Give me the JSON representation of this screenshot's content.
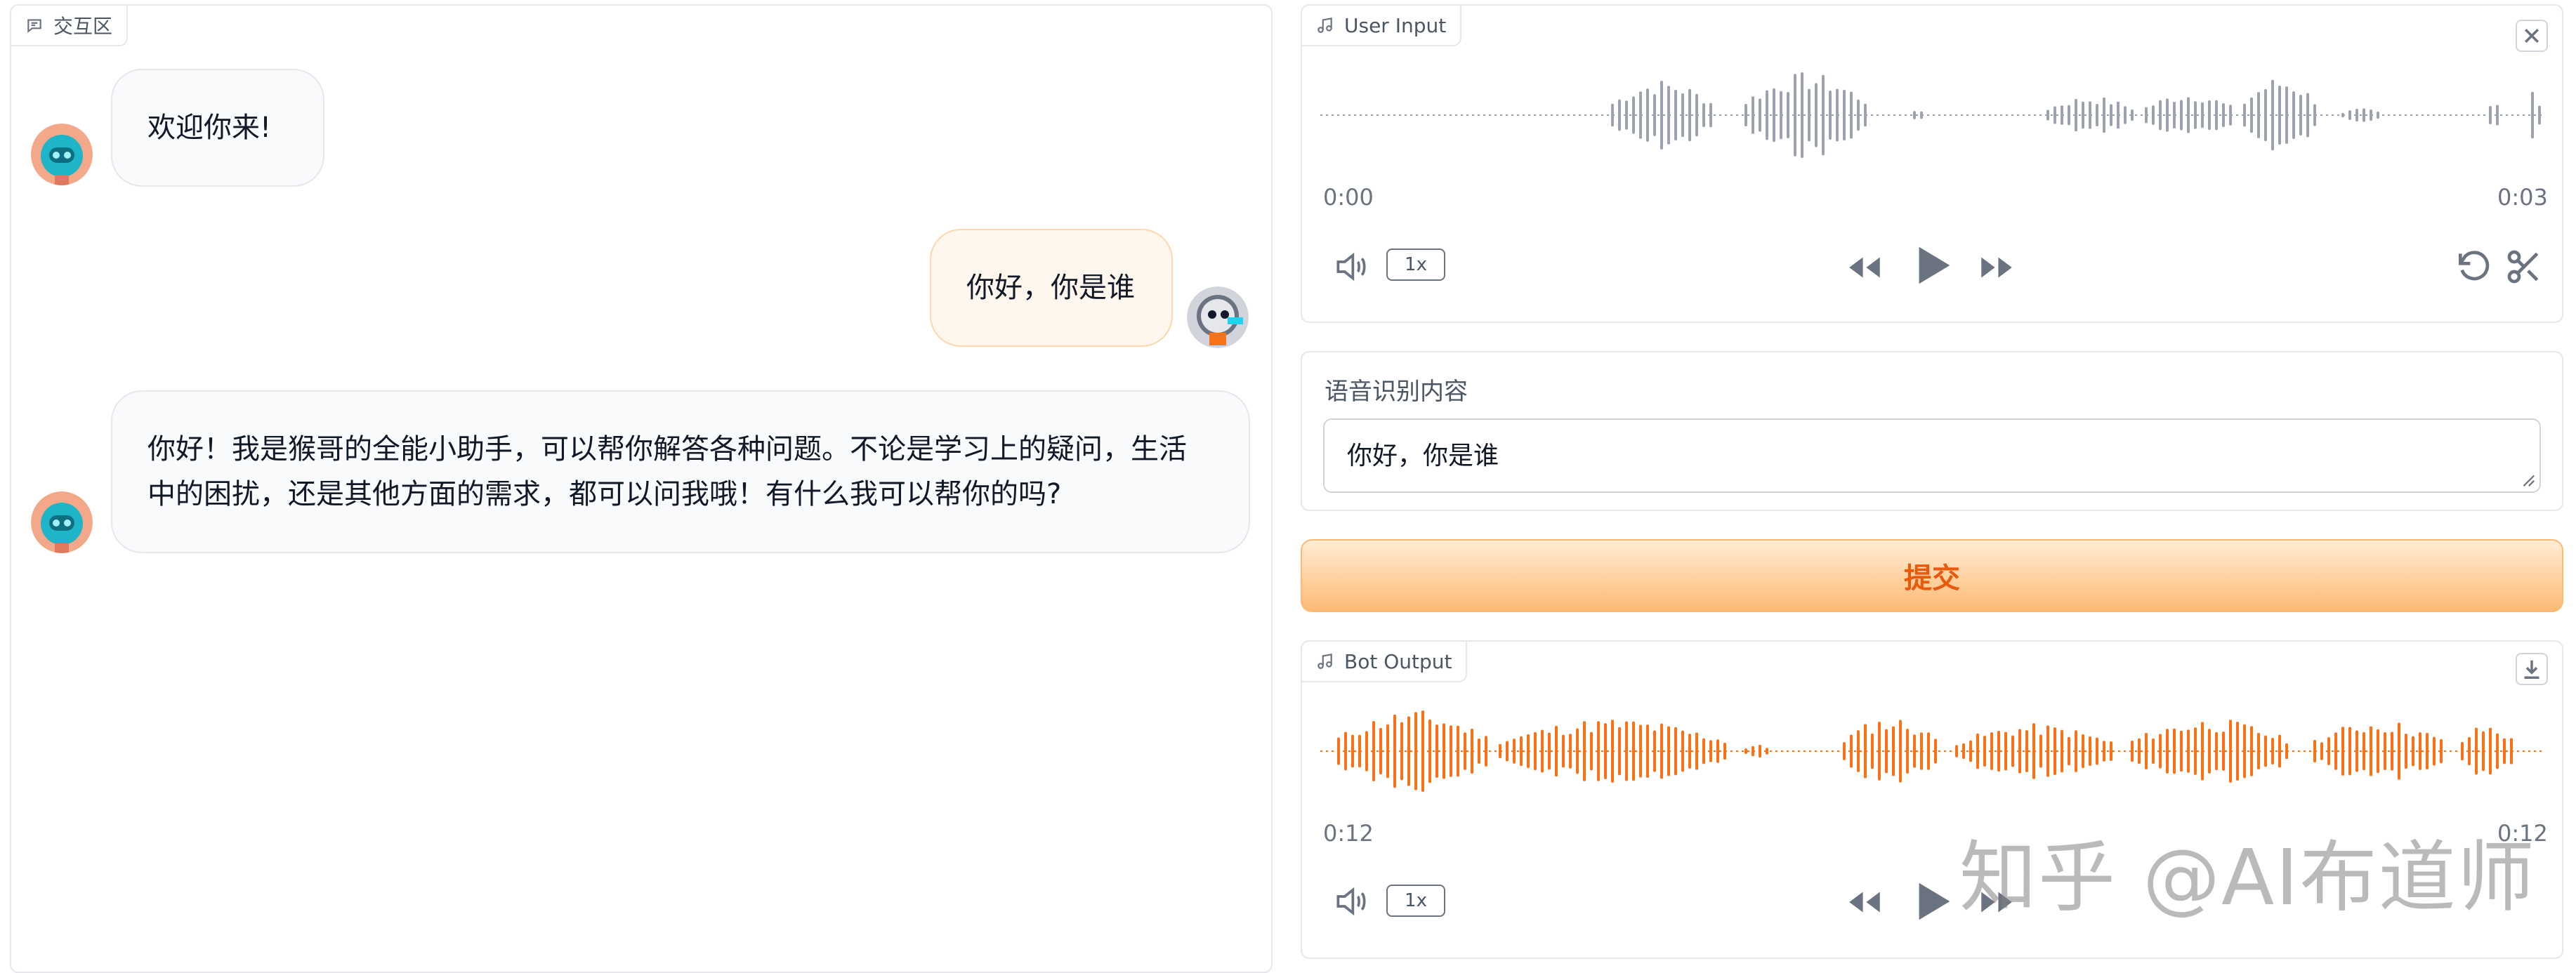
{
  "chat": {
    "label": "交互区",
    "messages": [
      {
        "role": "bot",
        "text": "欢迎你来!"
      },
      {
        "role": "user",
        "text": "你好，你是谁"
      },
      {
        "role": "bot",
        "text": "你好！我是猴哥的全能小助手，可以帮你解答各种问题。不论是学习上的疑问，生活中的困扰，还是其他方面的需求，都可以问我哦！有什么我可以帮你的吗?"
      }
    ]
  },
  "user_input": {
    "label": "User Input",
    "time_start": "0:00",
    "time_end": "0:03",
    "speed": "1x",
    "waveform_color": "#9ca3af"
  },
  "asr": {
    "label": "语音识别内容",
    "value": "你好，你是谁"
  },
  "submit": {
    "label": "提交"
  },
  "bot_output": {
    "label": "Bot Output",
    "time_start": "0:12",
    "time_end": "0:12",
    "speed": "1x",
    "waveform_color": "#f97316"
  },
  "watermark": "知乎 @AI布道师",
  "colors": {
    "accent": "#f97316",
    "border": "#e5e7eb"
  }
}
